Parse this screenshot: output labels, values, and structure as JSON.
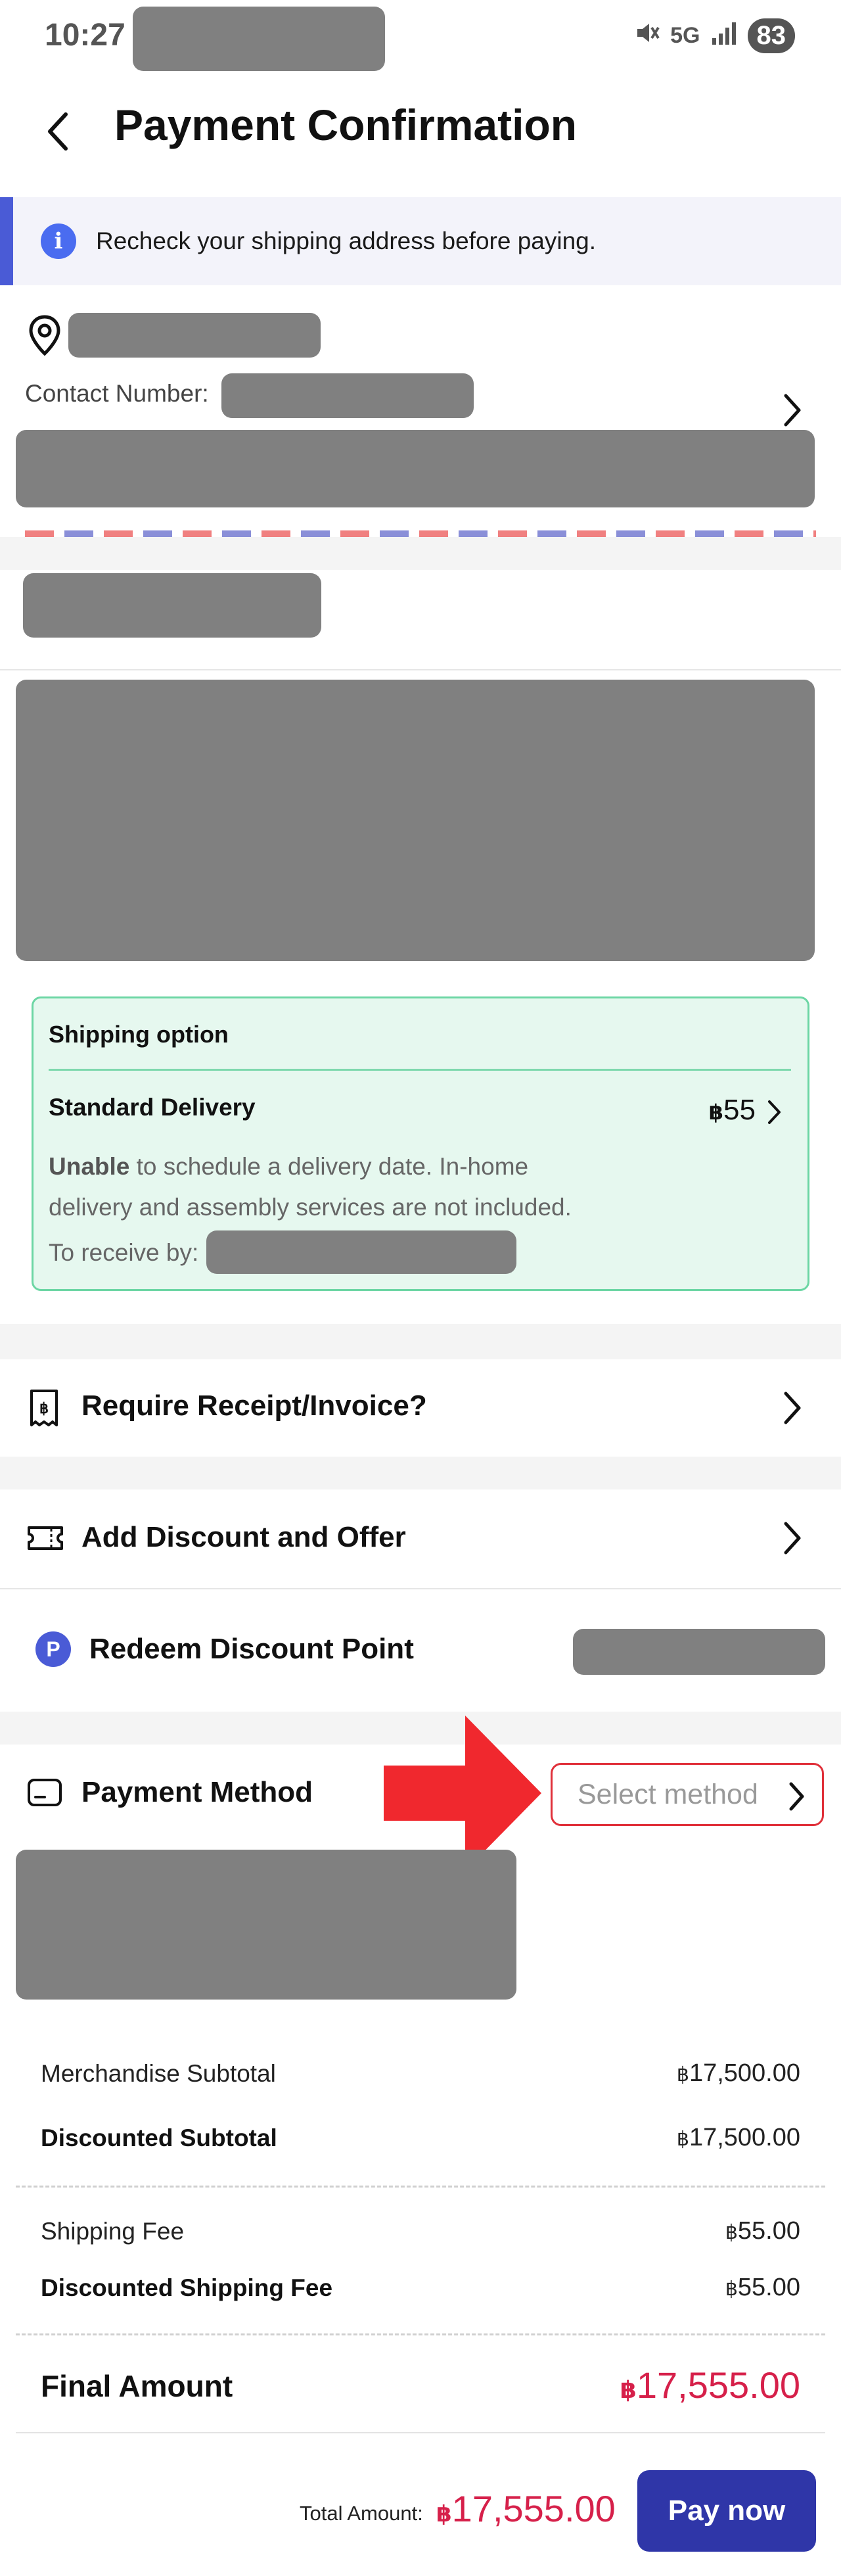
{
  "status_bar": {
    "time": "10:27",
    "battery": "83",
    "network": "5G"
  },
  "header": {
    "title": "Payment Confirmation"
  },
  "notice": {
    "text": "Recheck your shipping address before paying."
  },
  "address": {
    "contact_label": "Contact Number:"
  },
  "shipping": {
    "title": "Shipping option",
    "method": "Standard Delivery",
    "currency": "฿",
    "price": "55",
    "desc_bold": "Unable",
    "desc_rest": " to schedule a delivery date. In-home delivery and assembly services are not included.",
    "receive_label": "To receive by:"
  },
  "rows": {
    "receipt": "Require Receipt/Invoice?",
    "discount": "Add Discount and Offer",
    "points": "Redeem Discount Point",
    "points_icon_letter": "P",
    "payment": "Payment Method",
    "select_method": "Select method"
  },
  "summary": {
    "currency": "฿",
    "merch_label": "Merchandise Subtotal",
    "merch_val": "17,500.00",
    "disc_sub_label": "Discounted Subtotal",
    "disc_sub_val": "17,500.00",
    "ship_label": "Shipping Fee",
    "ship_val": "55.00",
    "disc_ship_label": "Discounted Shipping Fee",
    "disc_ship_val": "55.00",
    "final_label": "Final Amount",
    "final_val": "17,555.00"
  },
  "footer": {
    "total_label": "Total Amount:",
    "currency": "฿",
    "total_val": "17,555.00",
    "pay_button": "Pay now"
  },
  "colors": {
    "accent": "#2f36a8",
    "price_red": "#d6204a",
    "shipping_bg": "#e6f8ef",
    "notice_bar": "#4a5bd6",
    "highlight_arrow": "#f0282e"
  }
}
